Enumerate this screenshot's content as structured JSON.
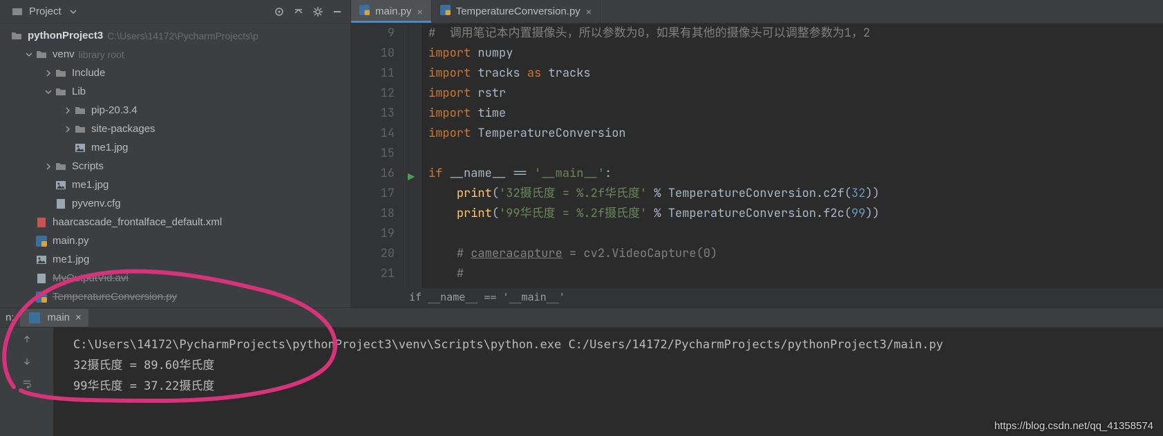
{
  "project_panel": {
    "title": "Project",
    "root": {
      "name": "pythonProject3",
      "path": "C:\\Users\\14172\\PycharmProjects\\p"
    },
    "tree": [
      {
        "depth": 0,
        "caret": "down",
        "kind": "folder",
        "name": "venv",
        "hint": "library root"
      },
      {
        "depth": 1,
        "caret": "right",
        "kind": "folder",
        "name": "Include"
      },
      {
        "depth": 1,
        "caret": "down",
        "kind": "folder",
        "name": "Lib"
      },
      {
        "depth": 2,
        "caret": "right",
        "kind": "folder",
        "name": "pip-20.3.4"
      },
      {
        "depth": 2,
        "caret": "right",
        "kind": "folder",
        "name": "site-packages"
      },
      {
        "depth": 2,
        "caret": "none",
        "kind": "image",
        "name": "me1.jpg"
      },
      {
        "depth": 1,
        "caret": "right",
        "kind": "folder",
        "name": "Scripts"
      },
      {
        "depth": 1,
        "caret": "none",
        "kind": "image",
        "name": "me1.jpg"
      },
      {
        "depth": 1,
        "caret": "none",
        "kind": "file",
        "name": "pyvenv.cfg"
      },
      {
        "depth": 0,
        "caret": "none",
        "kind": "xml",
        "name": "haarcascade_frontalface_default.xml"
      },
      {
        "depth": 0,
        "caret": "none",
        "kind": "python",
        "name": "main.py"
      },
      {
        "depth": 0,
        "caret": "none",
        "kind": "image",
        "name": "me1.jpg"
      },
      {
        "depth": 0,
        "caret": "none",
        "kind": "file",
        "name": "MyOutputVid.avi",
        "striked": true
      },
      {
        "depth": 0,
        "caret": "none",
        "kind": "python",
        "name": "TemperatureConversion.py",
        "striked": true
      }
    ]
  },
  "editor": {
    "tabs": [
      {
        "label": "main.py",
        "active": true
      },
      {
        "label": "TemperatureConversion.py",
        "active": false
      }
    ],
    "lines": [
      {
        "n": 9,
        "html": "<span class='c-cmt'>#  调用笔记本内置摄像头，所以参数为0，如果有其他的摄像头可以调整参数为1，2</span>"
      },
      {
        "n": 10,
        "html": "<span class='c-kw'>import</span> numpy"
      },
      {
        "n": 11,
        "html": "<span class='c-kw'>import</span> tracks <span class='c-kw'>as</span> tracks"
      },
      {
        "n": 12,
        "html": "<span class='c-kw'>import</span> rstr"
      },
      {
        "n": 13,
        "html": "<span class='c-kw'>import</span> time"
      },
      {
        "n": 14,
        "html": "<span class='c-kw'>import</span> TemperatureConversion"
      },
      {
        "n": 15,
        "html": ""
      },
      {
        "n": 16,
        "run": true,
        "html": "<span class='c-kw'>if</span> __name__ == <span class='c-str'>'__main__'</span>:"
      },
      {
        "n": 17,
        "html": "    <span class='c-func'>print</span>(<span class='c-str'>'32摄氏度 = %.2f华氏度'</span> % TemperatureConversion.c2f(<span class='c-num'>32</span>))"
      },
      {
        "n": 18,
        "html": "    <span class='c-func'>print</span>(<span class='c-str'>'99华氏度 = %.2f摄氏度'</span> % TemperatureConversion.f2c(<span class='c-num'>99</span>))"
      },
      {
        "n": 19,
        "html": ""
      },
      {
        "n": 20,
        "html": "    <span class='c-cmt'># <span class='c-under'>cameracapture</span> = cv2.VideoCapture(0)</span>"
      },
      {
        "n": 21,
        "html": "    <span class='c-cmt'>#</span>"
      }
    ],
    "breadcrumb": "if __name__ == '__main__'"
  },
  "run_panel": {
    "prefix": "n:",
    "tab_label": "main",
    "console_lines": [
      "C:\\Users\\14172\\PycharmProjects\\pythonProject3\\venv\\Scripts\\python.exe C:/Users/14172/PycharmProjects/pythonProject3/main.py",
      "32摄氏度 = 89.60华氏度",
      "99华氏度 = 37.22摄氏度"
    ]
  },
  "watermark": "https://blog.csdn.net/qq_41358574"
}
